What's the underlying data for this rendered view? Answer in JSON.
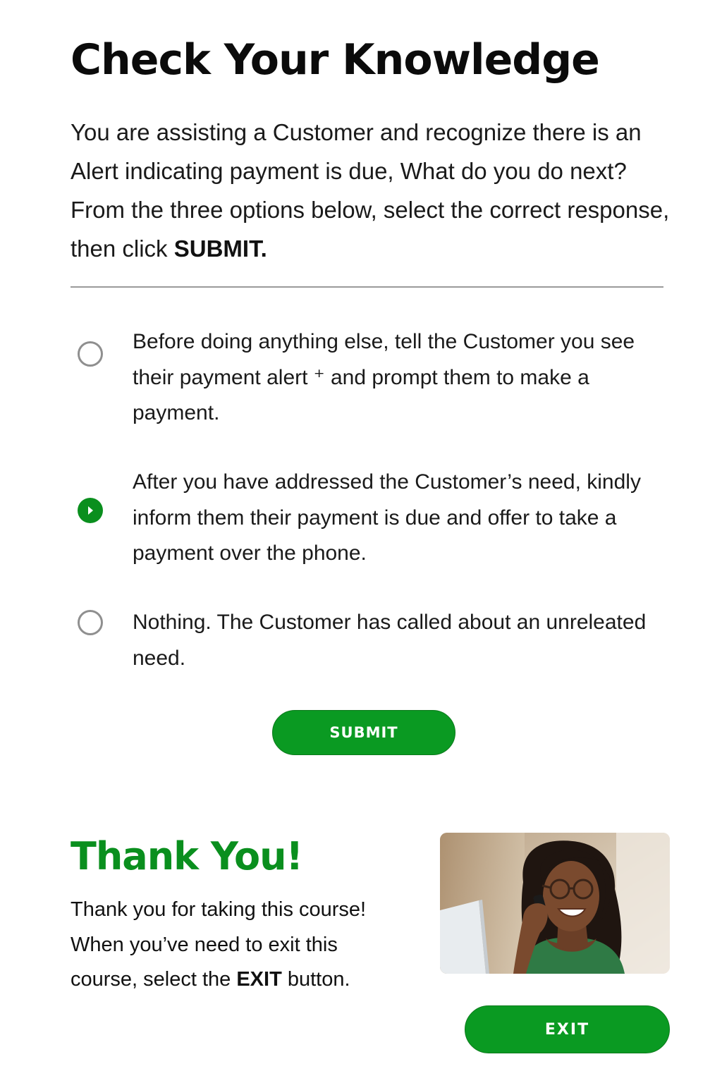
{
  "page": {
    "title": "Check Your Knowledge"
  },
  "question": {
    "text": "You are assisting a Customer and recognize there is an Alert indicating payment is due, What do you do next? From the three options below, select the correct response, then click ",
    "emphasis": "SUBMIT."
  },
  "options": [
    {
      "label": "Before doing anything else, tell the Customer you see their payment alert ⁺ and prompt them to make a payment.",
      "selected": false
    },
    {
      "label": "After you have addressed the Customer’s need, kindly inform them their payment is due and offer to take a payment over the phone.",
      "selected": true
    },
    {
      "label": "Nothing. The Customer has called about an unreleated need.",
      "selected": false
    }
  ],
  "submit": {
    "label": "SUBMIT"
  },
  "thanks": {
    "title": "Thank You!",
    "body": "Thank you for taking this course! When you’ve need to exit this course, select the ",
    "emphasis": "EXIT",
    "body_end": " button."
  },
  "photo": {
    "subject": "woman-on-phone-photo"
  },
  "exit": {
    "label": "EXIT"
  },
  "colors": {
    "accent": "#0a9a22",
    "title_green": "#0a8f1e",
    "radio_border": "#8f8f8f",
    "divider": "#9a9a9a"
  },
  "icons": {
    "radio_selected": "radio-selected-icon",
    "radio_unselected": "radio-unselected-icon"
  }
}
